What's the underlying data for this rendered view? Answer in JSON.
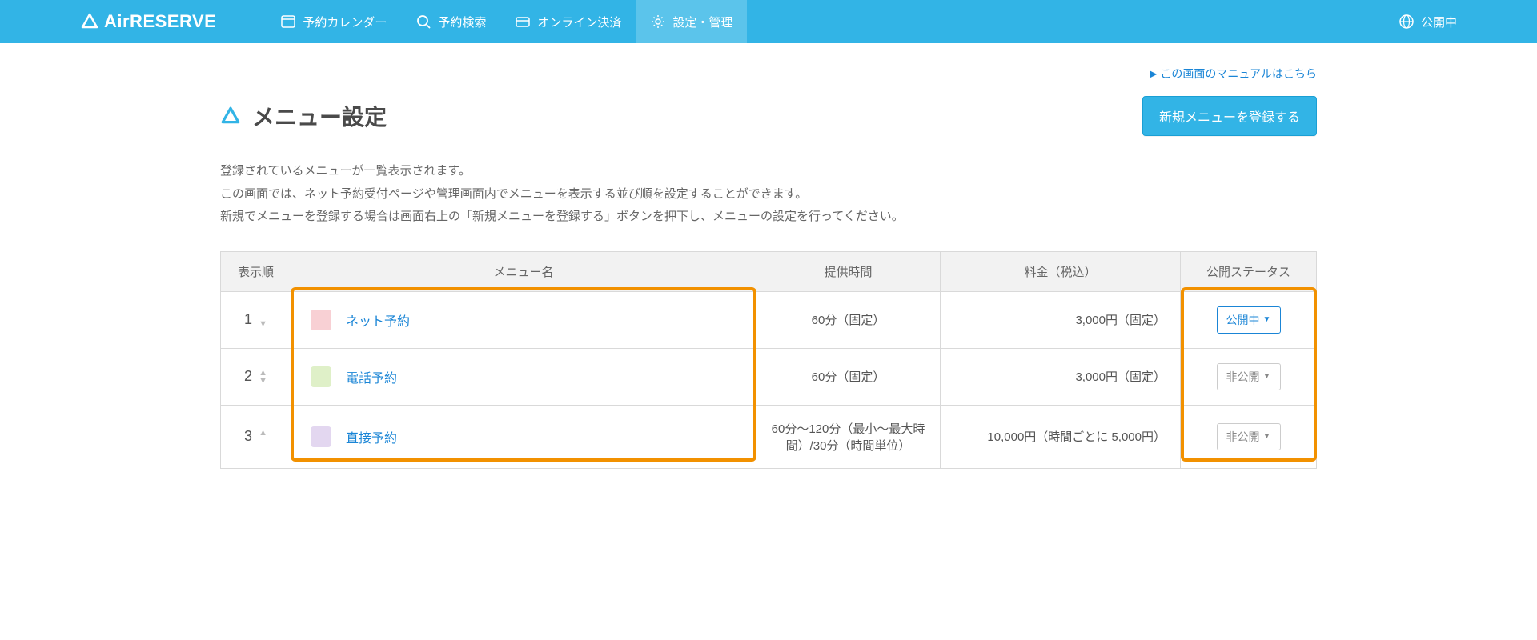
{
  "brand": "AirRESERVE",
  "nav": {
    "calendar": "予約カレンダー",
    "search": "予約検索",
    "payment": "オンライン決済",
    "settings": "設定・管理"
  },
  "publish_status": "公開中",
  "manual_link": "この画面のマニュアルはこちら",
  "page_title": "メニュー設定",
  "new_button": "新規メニューを登録する",
  "description": {
    "line1": "登録されているメニューが一覧表示されます。",
    "line2": "この画面では、ネット予約受付ページや管理画面内でメニューを表示する並び順を設定することができます。",
    "line3": "新規でメニューを登録する場合は画面右上の「新規メニューを登録する」ボタンを押下し、メニューの設定を行ってください。"
  },
  "table": {
    "headers": {
      "order": "表示順",
      "name": "メニュー名",
      "time": "提供時間",
      "price": "料金（税込）",
      "status": "公開ステータス"
    },
    "rows": [
      {
        "order": "1",
        "swatch": "#f8d0d4",
        "name": "ネット予約",
        "time": "60分（固定）",
        "price": "3,000円（固定）",
        "status_label": "公開中",
        "status_kind": "pub-on",
        "up": false,
        "down": true
      },
      {
        "order": "2",
        "swatch": "#dff0c8",
        "name": "電話予約",
        "time": "60分（固定）",
        "price": "3,000円（固定）",
        "status_label": "非公開",
        "status_kind": "pub-off",
        "up": true,
        "down": true
      },
      {
        "order": "3",
        "swatch": "#e3d7f0",
        "name": "直接予約",
        "time": "60分〜120分（最小〜最大時間）/30分（時間単位）",
        "price": "10,000円（時間ごとに 5,000円）",
        "status_label": "非公開",
        "status_kind": "pub-off",
        "up": true,
        "down": false
      }
    ]
  }
}
